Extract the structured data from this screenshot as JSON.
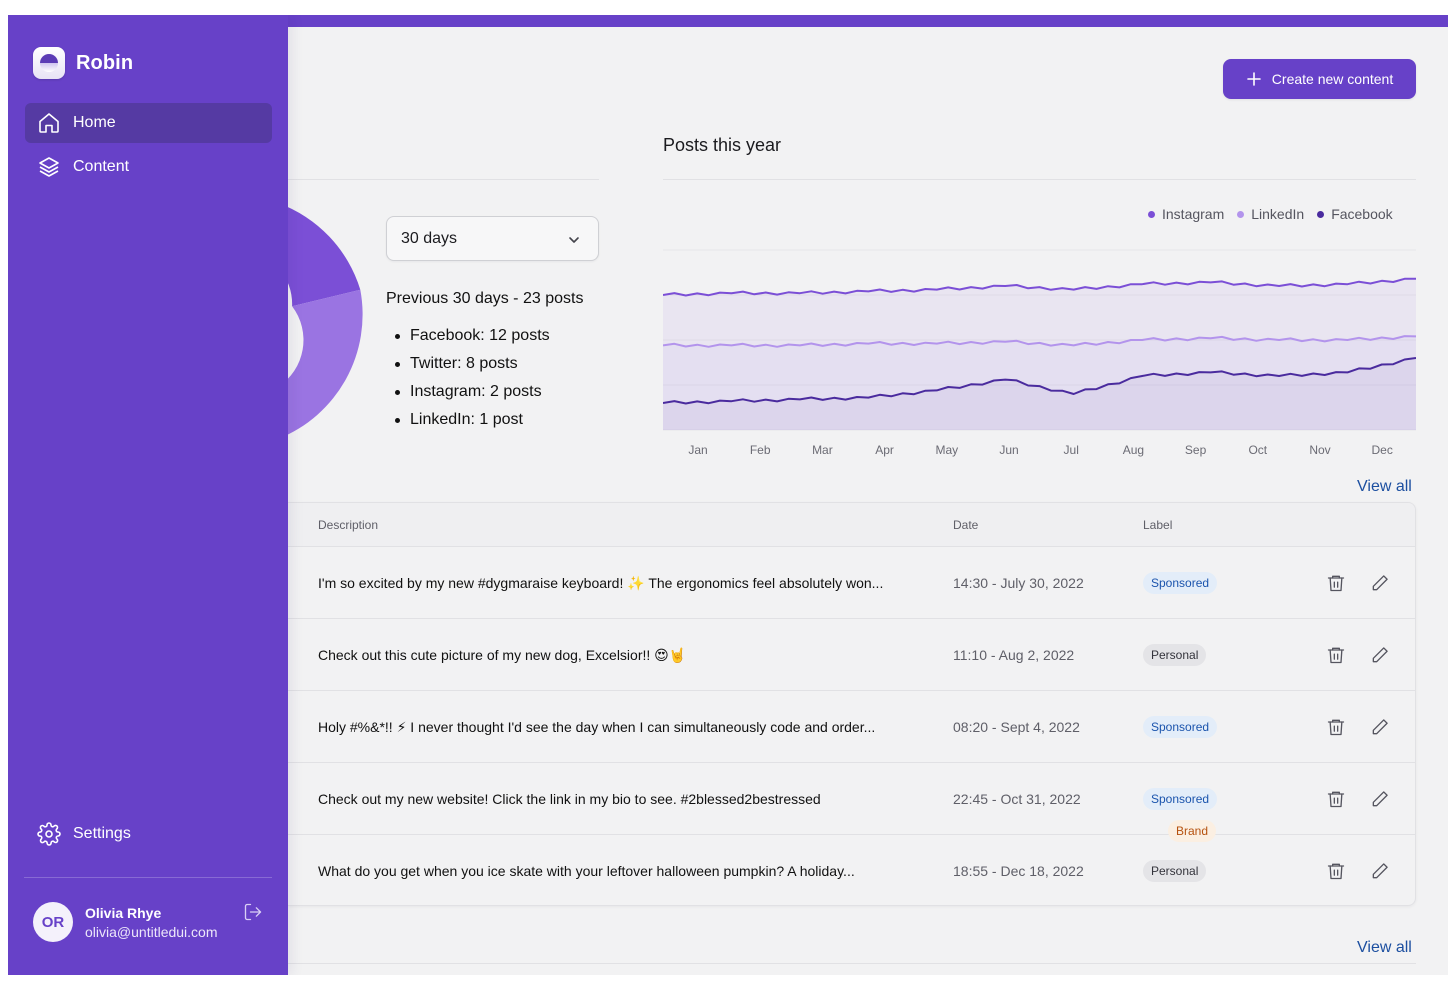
{
  "app": {
    "name": "Robin"
  },
  "sidebar": {
    "items": [
      {
        "label": "Home",
        "icon": "home-icon",
        "active": true
      },
      {
        "label": "Content",
        "icon": "layers-icon",
        "active": false
      }
    ],
    "settings_label": "Settings",
    "user": {
      "initials": "OR",
      "name": "Olivia Rhye",
      "email": "olivia@untitledui.com"
    }
  },
  "header": {
    "create_label": "Create new content"
  },
  "summary": {
    "range_select": "30 days",
    "title": "Previous 30 days - 23 posts",
    "items": [
      "Facebook: 12 posts",
      "Twitter: 8 posts",
      "Instagram: 2 posts",
      "LinkedIn: 1 post"
    ]
  },
  "colors": {
    "accent": "#6741c8",
    "instagram": "#7b4fd6",
    "linkedin": "#b394ec",
    "facebook": "#4a2b9e"
  },
  "chart_data": {
    "type": "line",
    "title": "Posts this year",
    "categories": [
      "Jan",
      "Feb",
      "Mar",
      "Apr",
      "May",
      "Jun",
      "Jul",
      "Aug",
      "Sep",
      "Oct",
      "Nov",
      "Dec"
    ],
    "legend_position": "top-right",
    "grid": true,
    "series": [
      {
        "name": "Instagram",
        "color": "#7b4fd6",
        "values": [
          75,
          76,
          76,
          77,
          78,
          80,
          78,
          81,
          82,
          80,
          81,
          84
        ]
      },
      {
        "name": "LinkedIn",
        "color": "#b394ec",
        "values": [
          47,
          47,
          47,
          48,
          48,
          49,
          47,
          50,
          51,
          50,
          50,
          52
        ]
      },
      {
        "name": "Facebook",
        "color": "#4a2b9e",
        "values": [
          15,
          16,
          17,
          18,
          22,
          28,
          20,
          30,
          32,
          30,
          32,
          40
        ]
      }
    ]
  },
  "table": {
    "view_all": "View all",
    "columns": [
      "Description",
      "Date",
      "Label"
    ],
    "rows": [
      {
        "description": "I'm so excited by my new #dygmaraise keyboard! ✨ The ergonomics feel absolutely won...",
        "date": "14:30 - July 30, 2022",
        "labels": [
          "Sponsored"
        ]
      },
      {
        "description": "Check out this cute picture of my new dog, Excelsior!! 😍🤘",
        "date": "11:10 - Aug 2, 2022",
        "labels": [
          "Personal"
        ]
      },
      {
        "description": "Holy #%&*!! ⚡ I never thought I'd see the day when I can simultaneously code and order...",
        "date": "08:20 - Sept 4, 2022",
        "labels": [
          "Sponsored"
        ]
      },
      {
        "description": "Check out my new website! Click the link in my bio to see. #2blessed2bestressed",
        "date": "22:45 - Oct 31, 2022",
        "labels": [
          "Brand",
          "Sponsored"
        ]
      },
      {
        "description": "What do you get when you ice skate with your leftover halloween pumpkin? A holiday...",
        "date": "18:55 - Dec 18, 2022",
        "labels": [
          "Personal"
        ]
      }
    ]
  },
  "second_view_all": "View all"
}
